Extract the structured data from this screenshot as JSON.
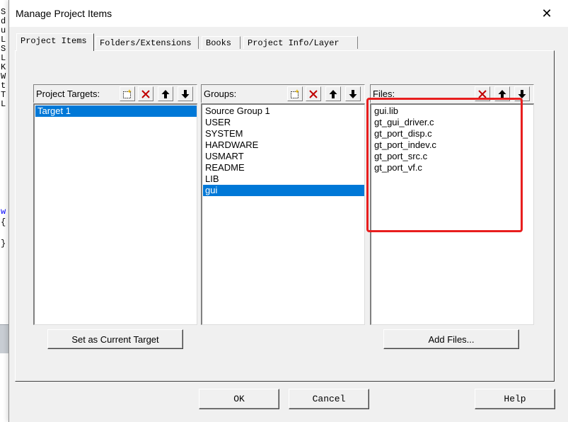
{
  "background": {
    "letters": [
      "S",
      "d",
      "u",
      "L",
      "S",
      "L",
      "K",
      "W",
      "t",
      "T",
      "L"
    ],
    "code_lines": [
      "w",
      "{",
      "",
      "}"
    ]
  },
  "dialog": {
    "title": "Manage Project Items",
    "close_glyph": "✕"
  },
  "tabs": [
    {
      "label": "Project Items",
      "active": true
    },
    {
      "label": "Folders/Extensions",
      "active": false
    },
    {
      "label": "Books",
      "active": false
    },
    {
      "label": "Project Info/Layer",
      "active": false
    }
  ],
  "targets": {
    "header": "Project Targets:",
    "items": [
      {
        "label": "Target 1",
        "selected": true
      }
    ],
    "button_label": "Set as Current Target"
  },
  "groups": {
    "header": "Groups:",
    "items": [
      {
        "label": "Source Group 1",
        "selected": false
      },
      {
        "label": "USER",
        "selected": false
      },
      {
        "label": "SYSTEM",
        "selected": false
      },
      {
        "label": "HARDWARE",
        "selected": false
      },
      {
        "label": "USMART",
        "selected": false
      },
      {
        "label": "README",
        "selected": false
      },
      {
        "label": "LIB",
        "selected": false
      },
      {
        "label": "gui",
        "selected": true
      }
    ]
  },
  "files": {
    "header": "Files:",
    "items": [
      {
        "label": "gui.lib",
        "selected": false
      },
      {
        "label": "gt_gui_driver.c",
        "selected": false
      },
      {
        "label": "gt_port_disp.c",
        "selected": false
      },
      {
        "label": "gt_port_indev.c",
        "selected": false
      },
      {
        "label": "gt_port_src.c",
        "selected": false
      },
      {
        "label": "gt_port_vf.c",
        "selected": false
      }
    ],
    "button_label": "Add Files..."
  },
  "footer": {
    "ok_label": "OK",
    "cancel_label": "Cancel",
    "help_label": "Help"
  },
  "colors": {
    "selection": "#0078d7",
    "delete_icon": "#c00000",
    "annotation": "#e81e1e"
  }
}
